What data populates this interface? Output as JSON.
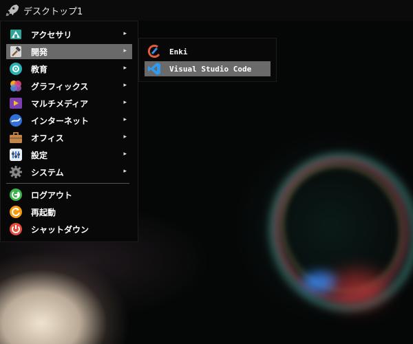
{
  "topbar": {
    "title": "デスクトップ1"
  },
  "main_menu": {
    "items": [
      {
        "label": "アクセサリ",
        "arrow": "▸"
      },
      {
        "label": "開発",
        "arrow": "▸"
      },
      {
        "label": "教育",
        "arrow": "▸"
      },
      {
        "label": "グラフィックス",
        "arrow": "▸"
      },
      {
        "label": "マルチメディア",
        "arrow": "▸"
      },
      {
        "label": "インターネット",
        "arrow": "▸"
      },
      {
        "label": "オフィス",
        "arrow": "▸"
      },
      {
        "label": "設定",
        "arrow": "▸"
      },
      {
        "label": "システム",
        "arrow": "▸"
      }
    ],
    "session": [
      {
        "label": "ログアウト"
      },
      {
        "label": "再起動"
      },
      {
        "label": "シャットダウン"
      }
    ],
    "selected": "開発"
  },
  "sub_menu": {
    "items": [
      {
        "label": "Enki"
      },
      {
        "label": "Visual Studio Code"
      }
    ],
    "selected": "Visual Studio Code"
  },
  "colors": {
    "menu_bg": "#080808",
    "selection": "#6a6a6a",
    "text": "#ffffff"
  }
}
